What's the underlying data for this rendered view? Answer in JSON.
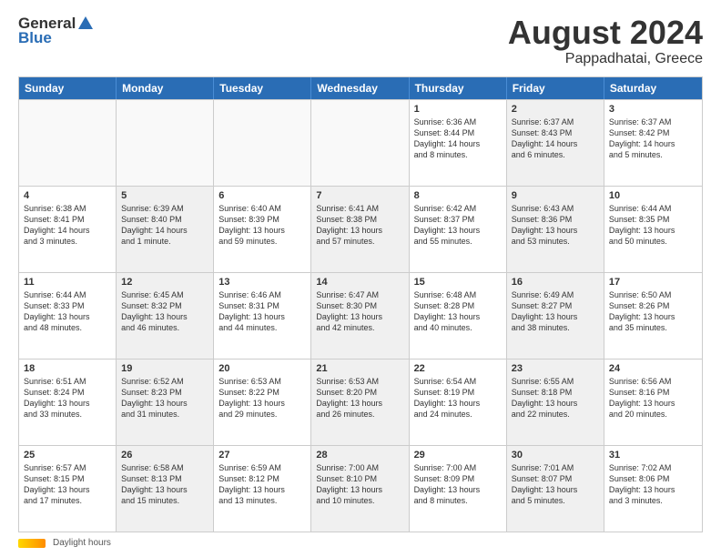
{
  "logo": {
    "general": "General",
    "blue": "Blue"
  },
  "title": "August 2024",
  "location": "Pappadhatai, Greece",
  "footer_label": "Daylight hours",
  "days_of_week": [
    "Sunday",
    "Monday",
    "Tuesday",
    "Wednesday",
    "Thursday",
    "Friday",
    "Saturday"
  ],
  "weeks": [
    [
      {
        "day": "",
        "empty": true
      },
      {
        "day": "",
        "empty": true
      },
      {
        "day": "",
        "empty": true
      },
      {
        "day": "",
        "empty": true
      },
      {
        "day": "1",
        "shaded": false,
        "lines": [
          "Sunrise: 6:36 AM",
          "Sunset: 8:44 PM",
          "Daylight: 14 hours",
          "and 8 minutes."
        ]
      },
      {
        "day": "2",
        "shaded": true,
        "lines": [
          "Sunrise: 6:37 AM",
          "Sunset: 8:43 PM",
          "Daylight: 14 hours",
          "and 6 minutes."
        ]
      },
      {
        "day": "3",
        "shaded": false,
        "lines": [
          "Sunrise: 6:37 AM",
          "Sunset: 8:42 PM",
          "Daylight: 14 hours",
          "and 5 minutes."
        ]
      }
    ],
    [
      {
        "day": "4",
        "shaded": false,
        "lines": [
          "Sunrise: 6:38 AM",
          "Sunset: 8:41 PM",
          "Daylight: 14 hours",
          "and 3 minutes."
        ]
      },
      {
        "day": "5",
        "shaded": true,
        "lines": [
          "Sunrise: 6:39 AM",
          "Sunset: 8:40 PM",
          "Daylight: 14 hours",
          "and 1 minute."
        ]
      },
      {
        "day": "6",
        "shaded": false,
        "lines": [
          "Sunrise: 6:40 AM",
          "Sunset: 8:39 PM",
          "Daylight: 13 hours",
          "and 59 minutes."
        ]
      },
      {
        "day": "7",
        "shaded": true,
        "lines": [
          "Sunrise: 6:41 AM",
          "Sunset: 8:38 PM",
          "Daylight: 13 hours",
          "and 57 minutes."
        ]
      },
      {
        "day": "8",
        "shaded": false,
        "lines": [
          "Sunrise: 6:42 AM",
          "Sunset: 8:37 PM",
          "Daylight: 13 hours",
          "and 55 minutes."
        ]
      },
      {
        "day": "9",
        "shaded": true,
        "lines": [
          "Sunrise: 6:43 AM",
          "Sunset: 8:36 PM",
          "Daylight: 13 hours",
          "and 53 minutes."
        ]
      },
      {
        "day": "10",
        "shaded": false,
        "lines": [
          "Sunrise: 6:44 AM",
          "Sunset: 8:35 PM",
          "Daylight: 13 hours",
          "and 50 minutes."
        ]
      }
    ],
    [
      {
        "day": "11",
        "shaded": false,
        "lines": [
          "Sunrise: 6:44 AM",
          "Sunset: 8:33 PM",
          "Daylight: 13 hours",
          "and 48 minutes."
        ]
      },
      {
        "day": "12",
        "shaded": true,
        "lines": [
          "Sunrise: 6:45 AM",
          "Sunset: 8:32 PM",
          "Daylight: 13 hours",
          "and 46 minutes."
        ]
      },
      {
        "day": "13",
        "shaded": false,
        "lines": [
          "Sunrise: 6:46 AM",
          "Sunset: 8:31 PM",
          "Daylight: 13 hours",
          "and 44 minutes."
        ]
      },
      {
        "day": "14",
        "shaded": true,
        "lines": [
          "Sunrise: 6:47 AM",
          "Sunset: 8:30 PM",
          "Daylight: 13 hours",
          "and 42 minutes."
        ]
      },
      {
        "day": "15",
        "shaded": false,
        "lines": [
          "Sunrise: 6:48 AM",
          "Sunset: 8:28 PM",
          "Daylight: 13 hours",
          "and 40 minutes."
        ]
      },
      {
        "day": "16",
        "shaded": true,
        "lines": [
          "Sunrise: 6:49 AM",
          "Sunset: 8:27 PM",
          "Daylight: 13 hours",
          "and 38 minutes."
        ]
      },
      {
        "day": "17",
        "shaded": false,
        "lines": [
          "Sunrise: 6:50 AM",
          "Sunset: 8:26 PM",
          "Daylight: 13 hours",
          "and 35 minutes."
        ]
      }
    ],
    [
      {
        "day": "18",
        "shaded": false,
        "lines": [
          "Sunrise: 6:51 AM",
          "Sunset: 8:24 PM",
          "Daylight: 13 hours",
          "and 33 minutes."
        ]
      },
      {
        "day": "19",
        "shaded": true,
        "lines": [
          "Sunrise: 6:52 AM",
          "Sunset: 8:23 PM",
          "Daylight: 13 hours",
          "and 31 minutes."
        ]
      },
      {
        "day": "20",
        "shaded": false,
        "lines": [
          "Sunrise: 6:53 AM",
          "Sunset: 8:22 PM",
          "Daylight: 13 hours",
          "and 29 minutes."
        ]
      },
      {
        "day": "21",
        "shaded": true,
        "lines": [
          "Sunrise: 6:53 AM",
          "Sunset: 8:20 PM",
          "Daylight: 13 hours",
          "and 26 minutes."
        ]
      },
      {
        "day": "22",
        "shaded": false,
        "lines": [
          "Sunrise: 6:54 AM",
          "Sunset: 8:19 PM",
          "Daylight: 13 hours",
          "and 24 minutes."
        ]
      },
      {
        "day": "23",
        "shaded": true,
        "lines": [
          "Sunrise: 6:55 AM",
          "Sunset: 8:18 PM",
          "Daylight: 13 hours",
          "and 22 minutes."
        ]
      },
      {
        "day": "24",
        "shaded": false,
        "lines": [
          "Sunrise: 6:56 AM",
          "Sunset: 8:16 PM",
          "Daylight: 13 hours",
          "and 20 minutes."
        ]
      }
    ],
    [
      {
        "day": "25",
        "shaded": false,
        "lines": [
          "Sunrise: 6:57 AM",
          "Sunset: 8:15 PM",
          "Daylight: 13 hours",
          "and 17 minutes."
        ]
      },
      {
        "day": "26",
        "shaded": true,
        "lines": [
          "Sunrise: 6:58 AM",
          "Sunset: 8:13 PM",
          "Daylight: 13 hours",
          "and 15 minutes."
        ]
      },
      {
        "day": "27",
        "shaded": false,
        "lines": [
          "Sunrise: 6:59 AM",
          "Sunset: 8:12 PM",
          "Daylight: 13 hours",
          "and 13 minutes."
        ]
      },
      {
        "day": "28",
        "shaded": true,
        "lines": [
          "Sunrise: 7:00 AM",
          "Sunset: 8:10 PM",
          "Daylight: 13 hours",
          "and 10 minutes."
        ]
      },
      {
        "day": "29",
        "shaded": false,
        "lines": [
          "Sunrise: 7:00 AM",
          "Sunset: 8:09 PM",
          "Daylight: 13 hours",
          "and 8 minutes."
        ]
      },
      {
        "day": "30",
        "shaded": true,
        "lines": [
          "Sunrise: 7:01 AM",
          "Sunset: 8:07 PM",
          "Daylight: 13 hours",
          "and 5 minutes."
        ]
      },
      {
        "day": "31",
        "shaded": false,
        "lines": [
          "Sunrise: 7:02 AM",
          "Sunset: 8:06 PM",
          "Daylight: 13 hours",
          "and 3 minutes."
        ]
      }
    ]
  ]
}
